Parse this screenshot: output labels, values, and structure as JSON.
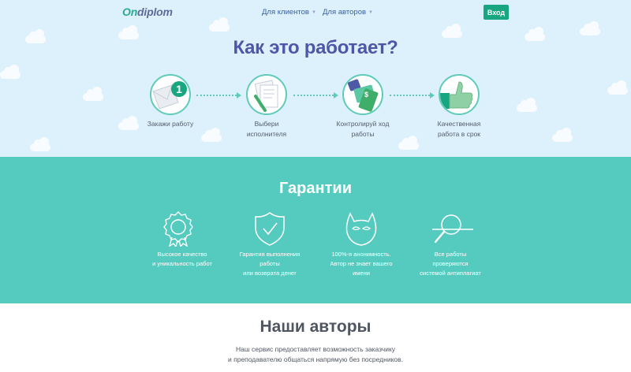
{
  "brand": {
    "logo_main": "Ondiplom",
    "accent": "#2aab8e",
    "logo_tail_color": "#5b6b9a"
  },
  "nav": {
    "clients": "Для клиентов",
    "authors": "Для авторов",
    "login": "Вход",
    "caret_icon": "chevron-down-icon"
  },
  "hero": {
    "title": "Как это работает?",
    "background": "#dcf1fb",
    "steps": [
      {
        "label_line1": "Закажи работу",
        "label_line2": "",
        "icon": "envelope-number-icon",
        "badge": "1"
      },
      {
        "label_line1": "Выбери",
        "label_line2": "исполнителя",
        "icon": "documents-pen-icon"
      },
      {
        "label_line1": "Контролируй ход",
        "label_line2": "работы",
        "icon": "wallet-money-icon"
      },
      {
        "label_line1": "Качественная",
        "label_line2": "работа в срок",
        "icon": "thumbs-up-icon"
      }
    ]
  },
  "guarantees": {
    "title": "Гарантии",
    "background": "#55cbbf",
    "items": [
      {
        "line1": "Высокое качество",
        "line2": "и уникальность работ",
        "line3": "",
        "icon": "award-ribbon-icon"
      },
      {
        "line1": "Гарантия выполнения",
        "line2": "работы",
        "line3": "или возврата денег",
        "icon": "shield-check-icon"
      },
      {
        "line1": "100%-я анонимность.",
        "line2": "Автор не знает вашего",
        "line3": "имени",
        "icon": "mask-icon"
      },
      {
        "line1": "Все работы",
        "line2": "проверяются",
        "line3": "системой антиплагиат",
        "icon": "magnifier-icon"
      }
    ]
  },
  "authors": {
    "title": "Наши авторы",
    "desc_line1": "Наш сервис предоставляет возможность заказчику",
    "desc_line2": "и преподавателю общаться напрямую без посредников."
  }
}
